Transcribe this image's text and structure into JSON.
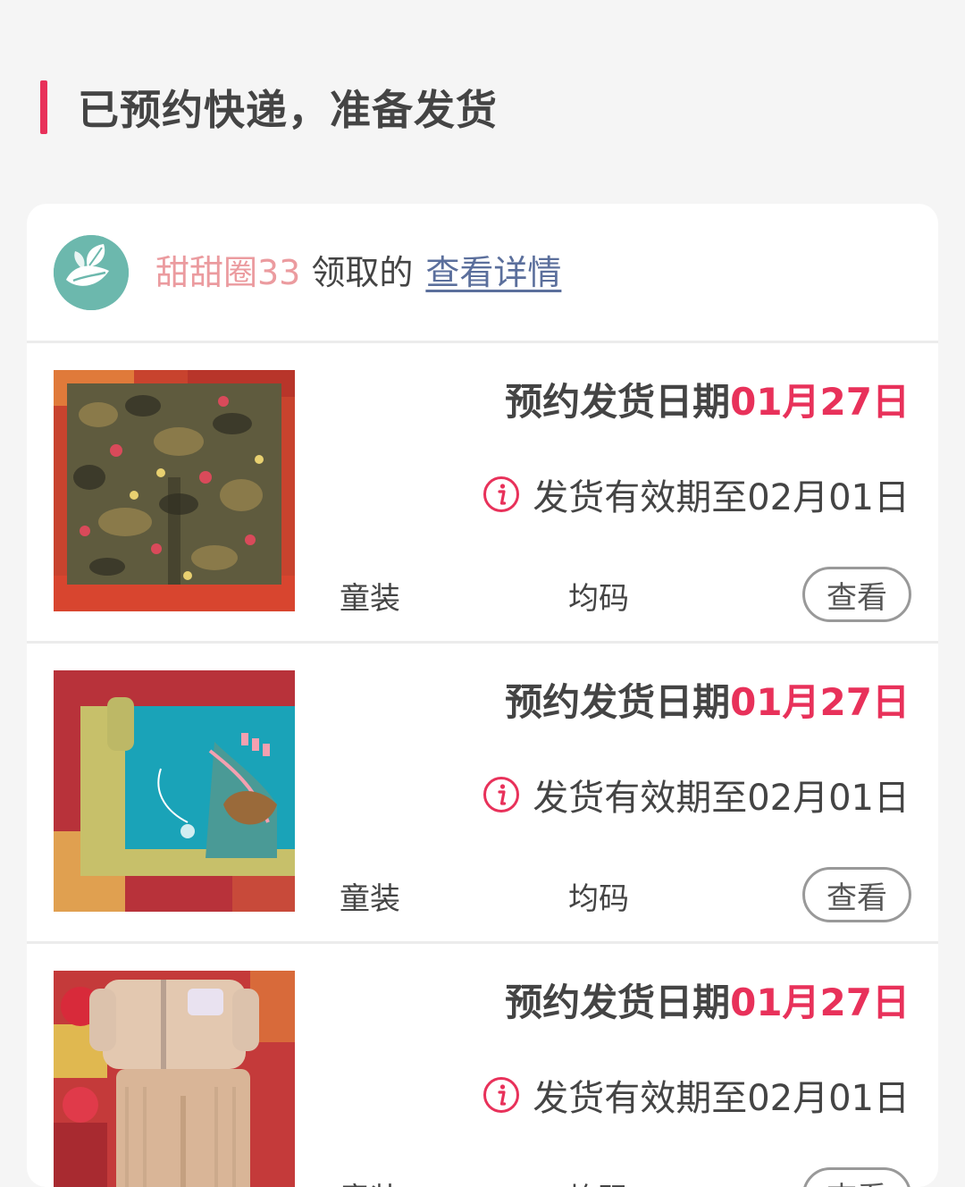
{
  "section": {
    "title": "已预约快递，准备发货"
  },
  "card": {
    "user_name": "甜甜圈33",
    "claim_text": "领取的",
    "detail_link": "查看详情"
  },
  "items": [
    {
      "ship_label": "预约发货日期",
      "ship_date": "01月27日",
      "validity": "发货有效期至02月01日",
      "category": "童装",
      "size": "均码",
      "button": "查看",
      "image_desc": "camouflage-pants"
    },
    {
      "ship_label": "预约发货日期",
      "ship_date": "01月27日",
      "validity": "发货有效期至02月01日",
      "category": "童装",
      "size": "均码",
      "button": "查看",
      "image_desc": "teal-sweater"
    },
    {
      "ship_label": "预约发货日期",
      "ship_date": "01月27日",
      "validity": "发货有效期至02月01日",
      "category": "童装",
      "size": "均码",
      "button": "查看",
      "image_desc": "beige-outfit"
    }
  ],
  "colors": {
    "accent": "#e8315a",
    "user_name": "#eb9b9f",
    "link": "#5b6f9c",
    "avatar": "#6cb8ad"
  },
  "icons": {
    "avatar": "leaf-icon",
    "validity": "info-icon"
  }
}
